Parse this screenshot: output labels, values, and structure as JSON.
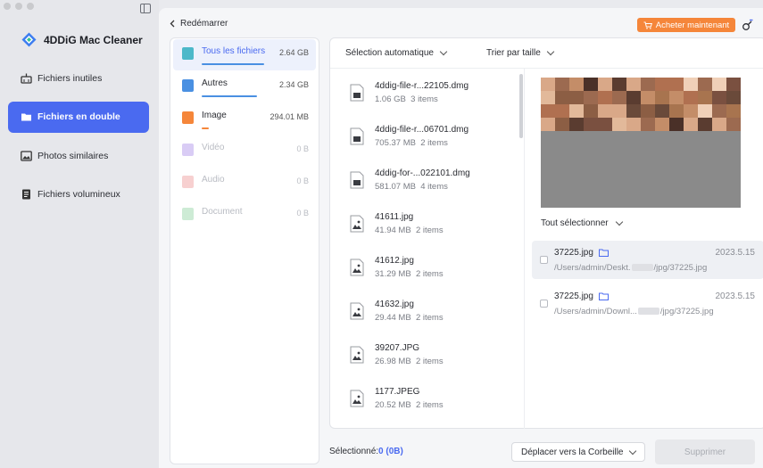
{
  "app": {
    "name": "4DDiG Mac Cleaner"
  },
  "sidebar": {
    "items": [
      {
        "label": "Fichiers inutiles",
        "icon": "broom-icon",
        "active": false
      },
      {
        "label": "Fichiers en double",
        "icon": "folder-icon",
        "active": true
      },
      {
        "label": "Photos similaires",
        "icon": "image-icon",
        "active": false
      },
      {
        "label": "Fichiers volumineux",
        "icon": "document-icon",
        "active": false
      }
    ]
  },
  "header": {
    "back_label": "Redémarrer",
    "buy_label": "Acheter maintenant"
  },
  "categories": [
    {
      "label": "Tous les fichiers",
      "size": "2.64  GB",
      "color": "#4cb8c9",
      "bar_color": "#4a90e2",
      "bar_width": 70,
      "active": true,
      "disabled": false
    },
    {
      "label": "Autres",
      "size": "2.34  GB",
      "color": "#4a90e2",
      "bar_color": "#4a90e2",
      "bar_width": 62,
      "active": false,
      "disabled": false
    },
    {
      "label": "Image",
      "size": "294.01  MB",
      "color": "#f5863a",
      "bar_color": "#f5863a",
      "bar_width": 8,
      "active": false,
      "disabled": false
    },
    {
      "label": "Vidéo",
      "size": "0  B",
      "color": "#d9ccf5",
      "active": false,
      "disabled": true
    },
    {
      "label": "Audio",
      "size": "0  B",
      "color": "#f7d0d0",
      "active": false,
      "disabled": true
    },
    {
      "label": "Document",
      "size": "0  B",
      "color": "#cdebd5",
      "active": false,
      "disabled": true
    }
  ],
  "toolbar": {
    "auto_select_label": "Sélection automatique",
    "sort_label": "Trier par taille"
  },
  "files": [
    {
      "name": "4ddig-file-r...22105.dmg",
      "size": "1.06  GB",
      "count": "3 items",
      "icon": "dmg-file-icon"
    },
    {
      "name": "4ddig-file-r...06701.dmg",
      "size": "705.37  MB",
      "count": "2 items",
      "icon": "dmg-file-icon"
    },
    {
      "name": "4ddig-for-...022101.dmg",
      "size": "581.07  MB",
      "count": "4 items",
      "icon": "dmg-file-icon"
    },
    {
      "name": "41611.jpg",
      "size": "41.94  MB",
      "count": "2 items",
      "icon": "image-file-icon"
    },
    {
      "name": "41612.jpg",
      "size": "31.29  MB",
      "count": "2 items",
      "icon": "image-file-icon"
    },
    {
      "name": "41632.jpg",
      "size": "29.44  MB",
      "count": "2 items",
      "icon": "image-file-icon"
    },
    {
      "name": "39207.JPG",
      "size": "26.98  MB",
      "count": "2 items",
      "icon": "image-file-icon"
    },
    {
      "name": "1177.JPEG",
      "size": "20.52  MB",
      "count": "2 items",
      "icon": "image-file-icon"
    }
  ],
  "detail": {
    "select_all_label": "Tout sélectionner",
    "duplicates": [
      {
        "name": "37225.jpg",
        "date": "2023.5.15",
        "path_start": "/Users/admin/Deskt.",
        "path_end": "/jpg/37225.jpg",
        "selected": true
      },
      {
        "name": "37225.jpg",
        "date": "2023.5.15",
        "path_start": "/Users/admin/Downl...",
        "path_end": "/jpg/37225.jpg",
        "selected": false
      }
    ]
  },
  "footer": {
    "selected_label": "Sélectionné:",
    "selected_value": "0 (0B)",
    "move_label": "Déplacer vers la Corbeille",
    "delete_label": "Supprimer"
  },
  "colors": {
    "accent": "#4a6af0",
    "buy": "#f5863a"
  }
}
